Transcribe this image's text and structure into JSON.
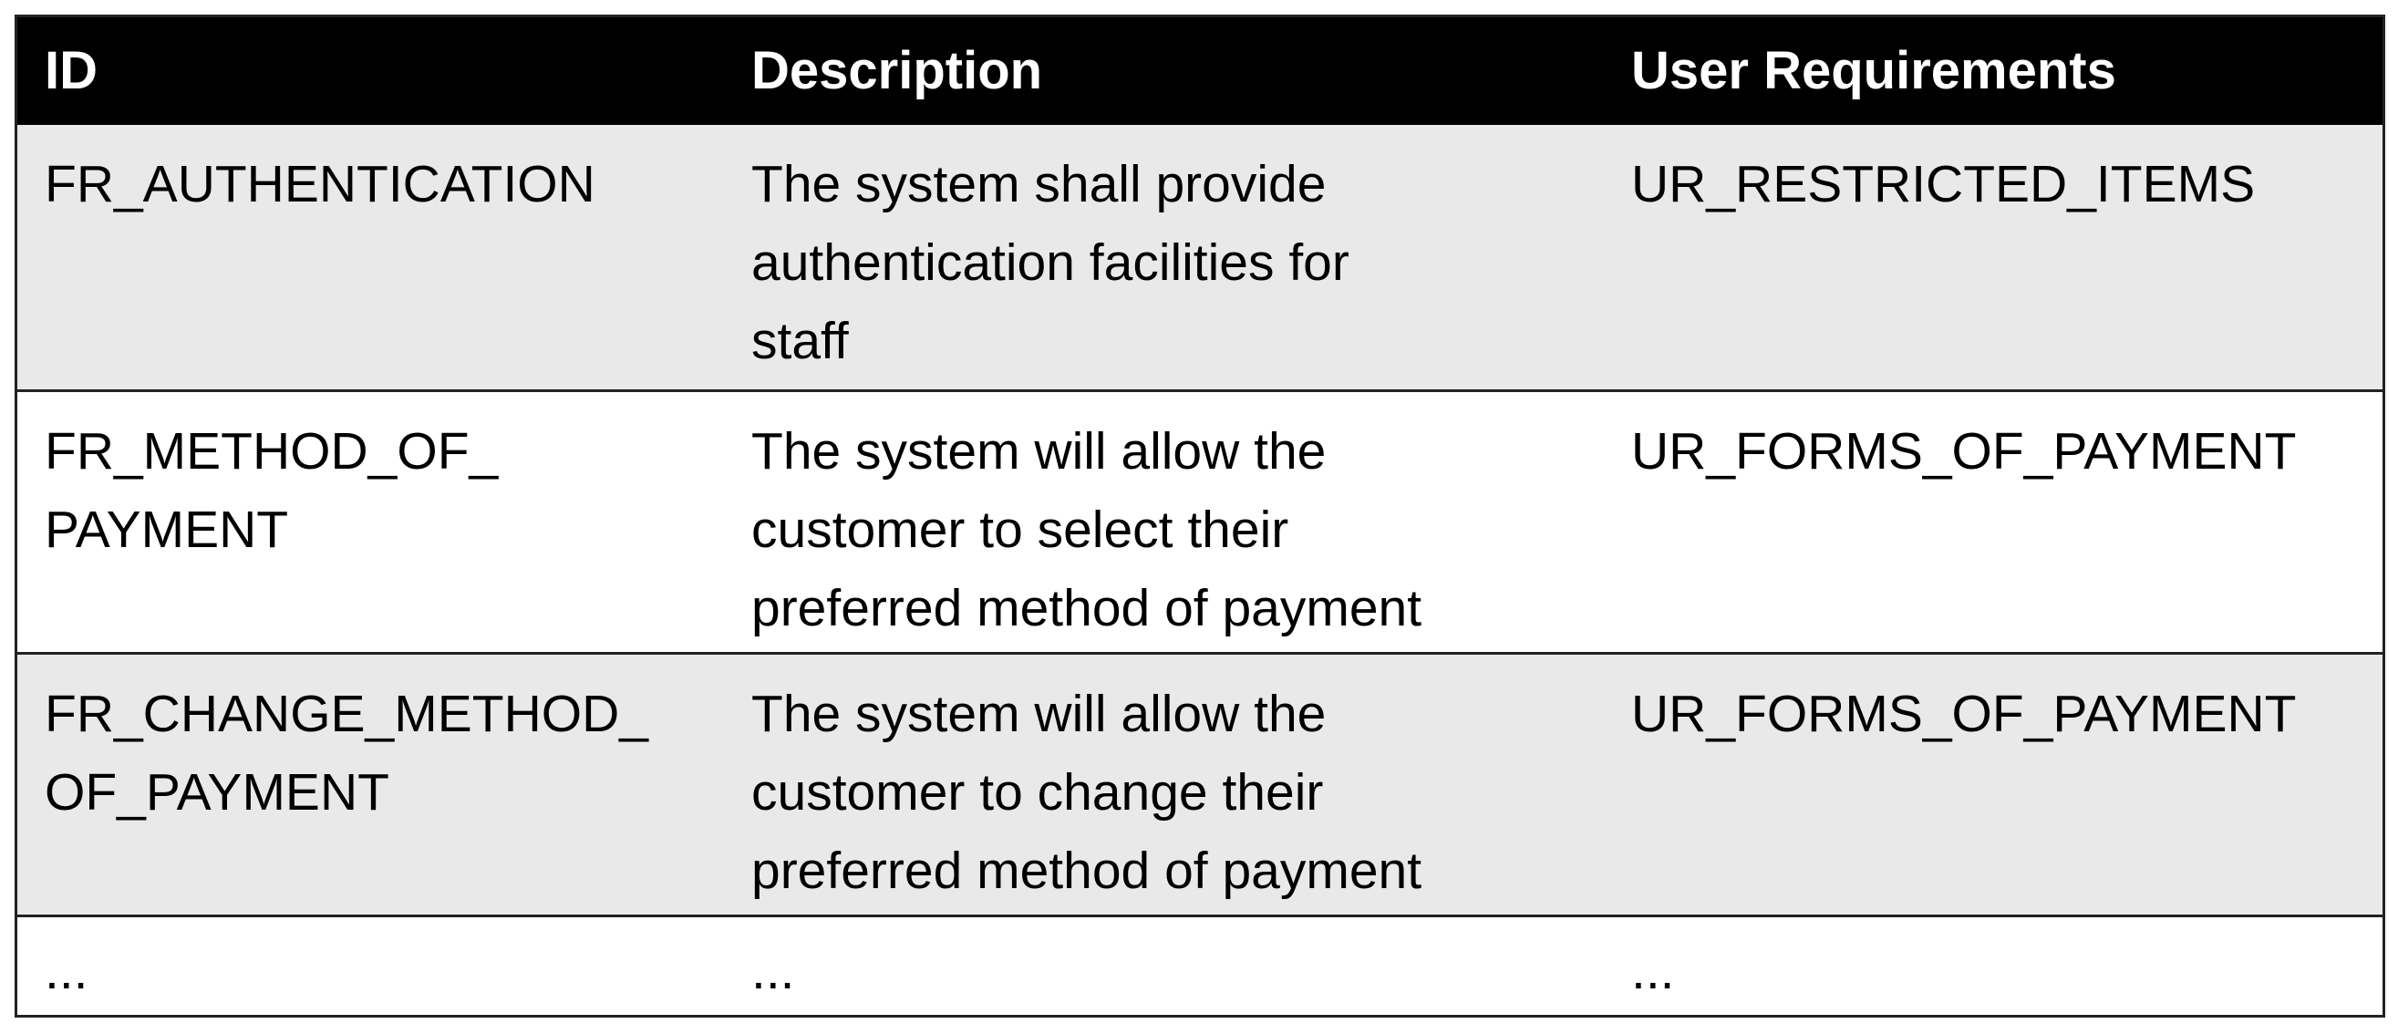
{
  "table": {
    "headers": [
      "ID",
      "Description",
      "User Requirements"
    ],
    "rows": [
      {
        "id": "FR_AUTHENTICATION",
        "description": "The system shall provide\nauthentication facilities for\nstaff",
        "user_requirements": "UR_RESTRICTED_ITEMS"
      },
      {
        "id": "FR_METHOD_OF_\nPAYMENT",
        "description": "The system will allow the\ncustomer to select their\npreferred method of payment",
        "user_requirements": "UR_FORMS_OF_PAYMENT"
      },
      {
        "id": "FR_CHANGE_METHOD_\nOF_PAYMENT",
        "description": "The system will allow the\ncustomer to change their\npreferred method of payment",
        "user_requirements": "UR_FORMS_OF_PAYMENT"
      },
      {
        "id": "...",
        "description": "...",
        "user_requirements": "..."
      }
    ]
  }
}
